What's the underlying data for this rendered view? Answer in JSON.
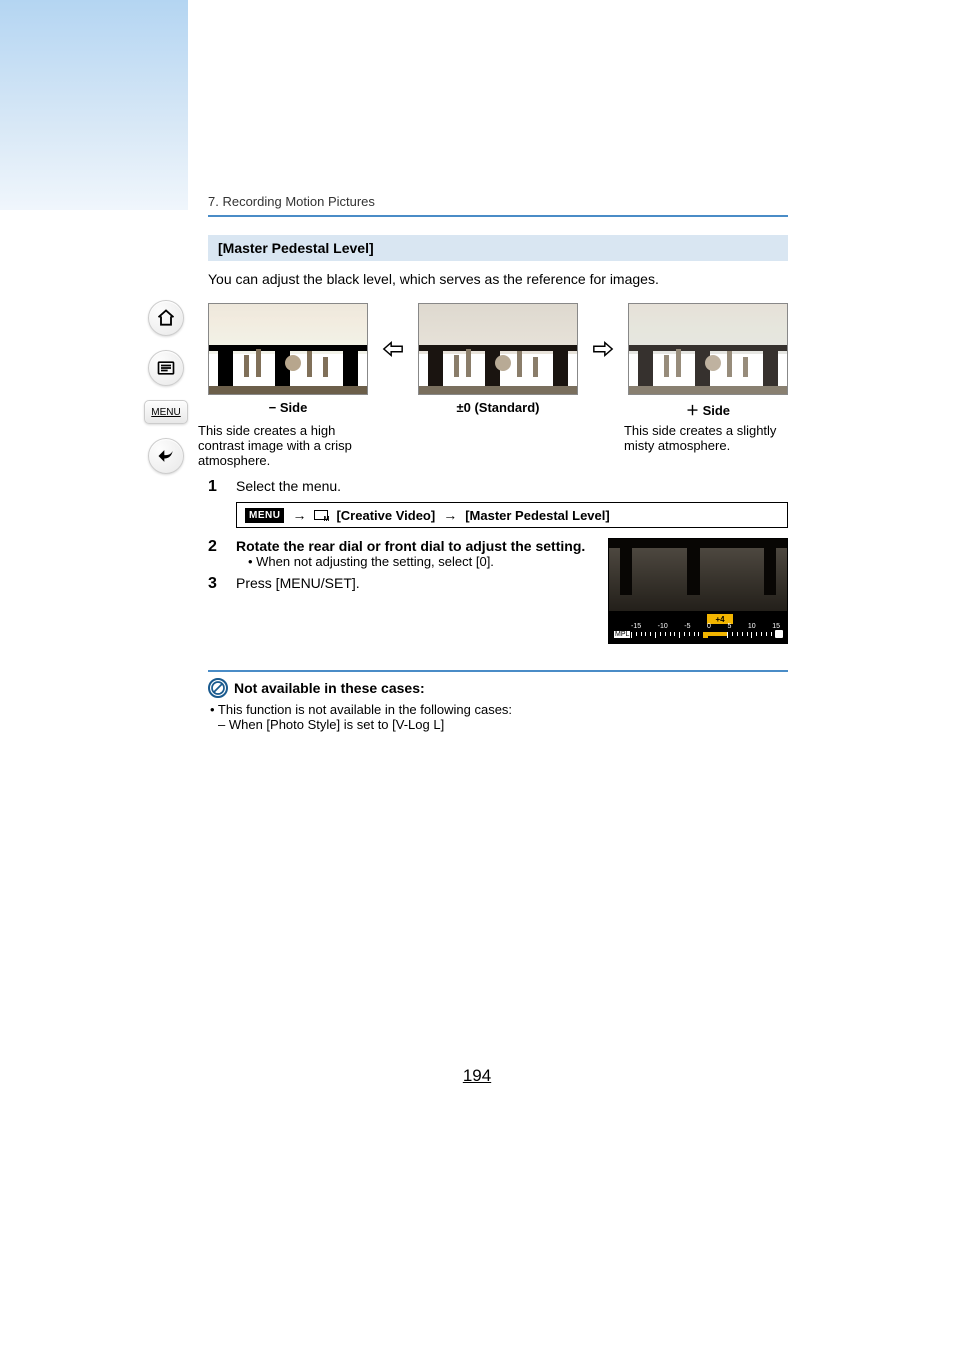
{
  "breadcrumb": "7. Recording Motion Pictures",
  "section_title": "[Master Pedestal Level]",
  "intro": "You can adjust the black level, which serves as the reference for images.",
  "examples": {
    "left": {
      "label": "− Side",
      "desc": "This side creates a high contrast image with a crisp atmosphere."
    },
    "center": {
      "label": "±0 (Standard)",
      "desc": ""
    },
    "right": {
      "label": "＋ Side",
      "desc": "This side creates a slightly misty atmosphere."
    }
  },
  "steps": {
    "s1": {
      "num": "1",
      "title": "Select the menu."
    },
    "s2": {
      "num": "2",
      "title": "Rotate the rear dial or front dial to adjust the setting.",
      "sub": "• When not adjusting the setting, select [0]."
    },
    "s3": {
      "num": "3",
      "title": "Press [MENU/SET]."
    }
  },
  "menu_path": {
    "menu_label": "MENU",
    "seg1": "[Creative Video]",
    "seg2": "[Master Pedestal Level]"
  },
  "preview": {
    "badge": "+4",
    "mpl": "MPL",
    "ticks": [
      "-15",
      "-10",
      "-5",
      "0",
      "5",
      "10",
      "15"
    ]
  },
  "not_available": {
    "title": "Not available in these cases:",
    "bullet": "• This function is not available in the following cases:",
    "sub": "– When [Photo Style] is set to [V-Log L]"
  },
  "sidebar": {
    "menu": "MENU"
  },
  "page_number": "194"
}
